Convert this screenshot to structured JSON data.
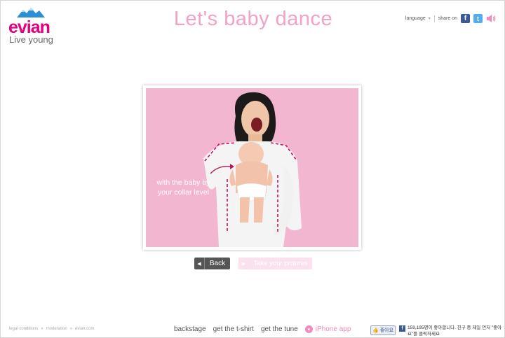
{
  "header": {
    "brand": "evian",
    "tagline": "Live young",
    "title": "Let's baby dance",
    "language_label": "language",
    "share_label": "share on",
    "facebook_glyph": "f",
    "twitter_glyph": "t",
    "icons": [
      "mountains-logo-icon",
      "chevron-down-icon",
      "facebook-icon",
      "twitter-icon",
      "speaker-icon"
    ]
  },
  "stage": {
    "caption_line1": "with the baby by",
    "caption_line2": "your collar level"
  },
  "buttons": {
    "back_label": "Back",
    "back_icon": "◀",
    "take_label": "Take your pictures",
    "take_icon": "▶"
  },
  "footer": {
    "legal": [
      "legal conditions",
      "moderation",
      "evian.com"
    ],
    "legal_sep": "»",
    "nav": [
      "backstage",
      "get the t-shirt",
      "get the tune"
    ],
    "iphone_label": "iPhone app",
    "like_label": "좋아요",
    "fb_text": "159,195명이 좋아합니다. 친구 중 제일 먼저 \"좋아요\"를 클릭하세요"
  },
  "colors": {
    "brand_pink": "#e6007e",
    "title_pink": "#f2a1c8",
    "photo_bg": "#f3b6d1",
    "facebook": "#3b5998",
    "twitter": "#55acee"
  }
}
